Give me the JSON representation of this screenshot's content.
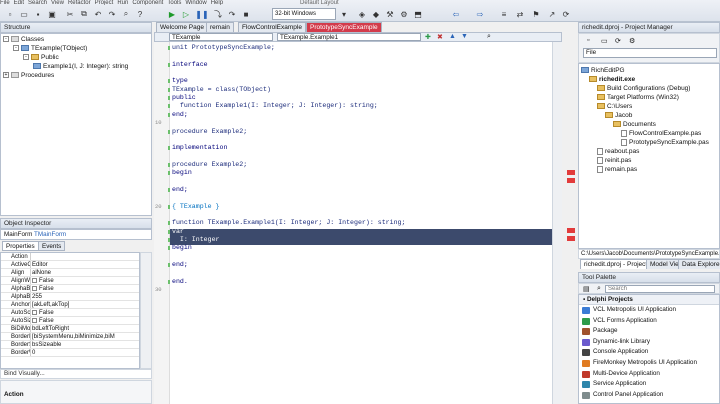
{
  "menu": [
    "File",
    "Edit",
    "Search",
    "View",
    "Refactor",
    "Project",
    "Run",
    "Component",
    "Tools",
    "Window",
    "Help"
  ],
  "window_title": "Default Layout",
  "toolbar": {
    "platform": "32-bit Windows"
  },
  "editor": {
    "tabs": [
      "Welcome Page",
      "remain",
      "FlowControlExample",
      "PrototypeSyncExample"
    ],
    "class_combo": "TExample",
    "method_combo": "TExample.Example1",
    "lines": [
      "unit PrototypeSyncExample;",
      "",
      "interface",
      "",
      "type",
      "TExample = class(TObject)",
      "public",
      "  function Example1(I: Integer; J: Integer): string;",
      "end;",
      "",
      "procedure Example2;",
      "",
      "implementation",
      "",
      "procedure Example2;",
      "begin",
      "",
      "end;",
      "",
      "{ TExample }",
      "",
      "function TExample.Example1(I: Integer; J: Integer): string;",
      "var",
      "  I: Integer",
      "begin",
      "",
      "end;",
      "",
      "end."
    ],
    "line_numbers": [
      "10",
      "20",
      "30"
    ]
  },
  "structure": {
    "title": "Structure",
    "items": [
      "Classes",
      "TExample(TObject)",
      "Public",
      "Example1(I, J: Integer): string",
      "Procedures"
    ]
  },
  "object_inspector": {
    "title": "Object Inspector",
    "selector_name": "MainForm",
    "selector_type": "TMainForm",
    "tabs": [
      "Properties",
      "Events"
    ],
    "rows": [
      {
        "k": "Action",
        "v": ""
      },
      {
        "k": "ActiveControl",
        "v": "Editor"
      },
      {
        "k": "Align",
        "v": "alNone"
      },
      {
        "k": "AlignWithMargins",
        "v": "False"
      },
      {
        "k": "AlphaBlend",
        "v": "False"
      },
      {
        "k": "AlphaBlendValue",
        "v": "255"
      },
      {
        "k": "Anchors",
        "v": "[akLeft,akTop]"
      },
      {
        "k": "AutoScroll",
        "v": "False"
      },
      {
        "k": "AutoSize",
        "v": "False"
      },
      {
        "k": "BiDiMode",
        "v": "bdLeftToRight"
      },
      {
        "k": "BorderIcons",
        "v": "[biSystemMenu,biMinimize,biM"
      },
      {
        "k": "BorderStyle",
        "v": "bsSizeable"
      },
      {
        "k": "BorderWidth",
        "v": "0"
      }
    ],
    "footer": "Bind Visually...",
    "status": "Action"
  },
  "project_manager": {
    "title": "richedit.dproj - Project Manager",
    "file_label": "File",
    "tree": [
      {
        "t": "RichEditPG",
        "d": 0
      },
      {
        "t": "richedit.exe",
        "d": 1
      },
      {
        "t": "Build Configurations (Debug)",
        "d": 2
      },
      {
        "t": "Target Platforms (Win32)",
        "d": 2
      },
      {
        "t": "C:\\Users",
        "d": 2
      },
      {
        "t": "Jacob",
        "d": 3
      },
      {
        "t": "Documents",
        "d": 4
      },
      {
        "t": "FlowControlExample.pas",
        "d": 5
      },
      {
        "t": "PrototypeSyncExample.pas",
        "d": 5
      },
      {
        "t": "reabout.pas",
        "d": 2
      },
      {
        "t": "reinit.pas",
        "d": 2
      },
      {
        "t": "remain.pas",
        "d": 2
      }
    ],
    "path": "C:\\Users\\Jacob\\Documents\\PrototypeSyncExample.",
    "tabs": [
      "richedit.dproj - Project...",
      "Model View",
      "Data Explorer"
    ]
  },
  "tool_palette": {
    "title": "Tool Palette",
    "search_placeholder": "Search",
    "category": "Delphi Projects",
    "items": [
      "VCL Metropolis UI Application",
      "VCL Forms Application",
      "Package",
      "Dynamic-link Library",
      "Console Application",
      "FireMonkey Metropolis UI Application",
      "Multi-Device Application",
      "Service Application",
      "Control Panel Application"
    ],
    "colors": [
      "#3a7bd5",
      "#2d9b4a",
      "#a0522d",
      "#6a5acd",
      "#444444",
      "#e07b21",
      "#c0392b",
      "#2e86ab",
      "#7f8c8d"
    ]
  }
}
